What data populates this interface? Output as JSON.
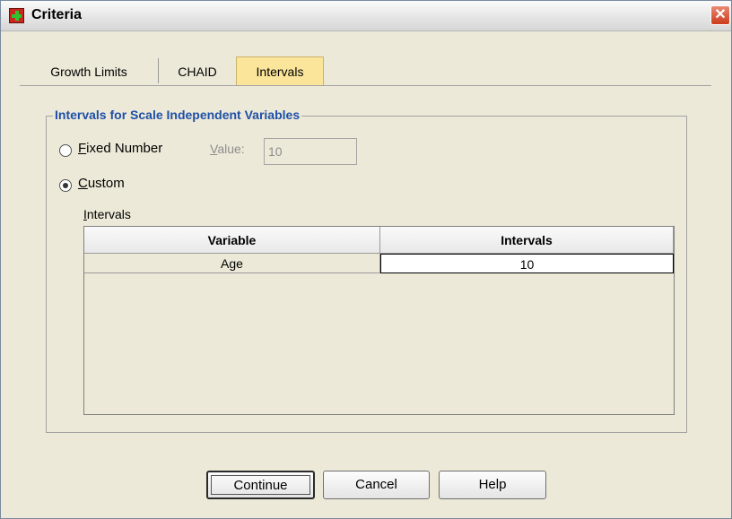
{
  "window": {
    "title": "Criteria",
    "close_label": "✕"
  },
  "tabs": [
    {
      "label": "Growth Limits",
      "active": false
    },
    {
      "label": "CHAID",
      "active": false
    },
    {
      "label": "Intervals",
      "active": true
    }
  ],
  "group": {
    "title": "Intervals for Scale Independent Variables",
    "fixed_number": {
      "mnemonic": "F",
      "rest": "ixed Number",
      "selected": false
    },
    "value": {
      "mnemonic": "V",
      "rest": "alue:",
      "value": "10",
      "enabled": false
    },
    "custom": {
      "mnemonic": "C",
      "rest": "ustom",
      "selected": true
    },
    "intervals_label": {
      "mnemonic": "I",
      "rest": "ntervals"
    },
    "table": {
      "columns": [
        "Variable",
        "Intervals"
      ],
      "rows": [
        {
          "variable": "Age",
          "intervals": "10"
        }
      ]
    }
  },
  "buttons": {
    "continue": "Continue",
    "cancel": "Cancel",
    "help": "Help"
  },
  "colors": {
    "tab_active": "#fbe59a",
    "group_title": "#1f4fa8",
    "background": "#ece9d8"
  }
}
